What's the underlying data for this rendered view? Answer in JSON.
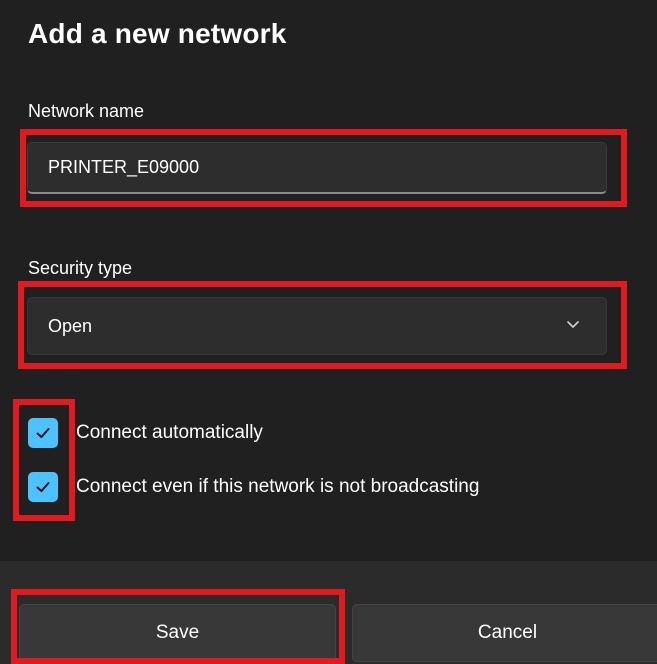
{
  "dialog": {
    "title": "Add a new network",
    "network_name": {
      "label": "Network name",
      "value": "PRINTER_E09000"
    },
    "security_type": {
      "label": "Security type",
      "selected": "Open",
      "icon": "chevron-down-icon"
    },
    "options": [
      {
        "label": "Connect automatically",
        "checked": true
      },
      {
        "label": "Connect even if this network is not broadcasting",
        "checked": true
      }
    ],
    "buttons": {
      "save_label": "Save",
      "cancel_label": "Cancel"
    }
  },
  "colors": {
    "background": "#202020",
    "footer": "#2b2b2b",
    "field": "#2d2d2d",
    "accent": "#4cc2ff",
    "highlight": "#e01a1f"
  }
}
